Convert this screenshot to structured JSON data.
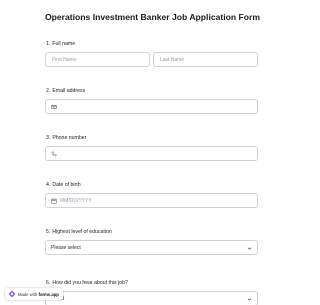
{
  "form": {
    "title": "Operations Investment Banker Job Application Form",
    "questions": [
      {
        "num": "1.",
        "label": "Full name",
        "first_placeholder": "First Name",
        "last_placeholder": "Last Name"
      },
      {
        "num": "2.",
        "label": "Email address",
        "icon": "envelope-icon"
      },
      {
        "num": "3.",
        "label": "Phone number",
        "icon": "phone-icon"
      },
      {
        "num": "4.",
        "label": "Date of birth",
        "icon": "calendar-icon",
        "placeholder": "MM/DD/YYYY"
      },
      {
        "num": "5.",
        "label": "Highest level of education",
        "value": "Please select"
      },
      {
        "num": "6.",
        "label": "How did you hear about this job?",
        "value": "select"
      }
    ]
  },
  "badge": {
    "prefix": "Made with",
    "brand": "forms.app"
  },
  "colors": {
    "border": "#cfd4da",
    "placeholder": "#9aa0a6",
    "badge_logo": "#7b4de0"
  }
}
